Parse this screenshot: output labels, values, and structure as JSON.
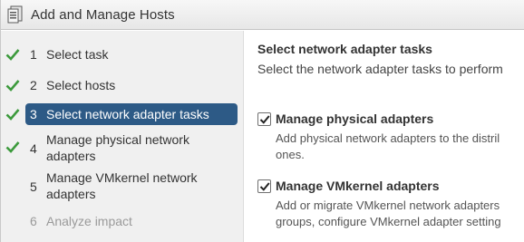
{
  "window": {
    "title": "Add and Manage Hosts",
    "icon": "hosts-wizard-icon"
  },
  "steps": [
    {
      "number": "1",
      "label": "Select task",
      "completed": true,
      "active": false
    },
    {
      "number": "2",
      "label": "Select hosts",
      "completed": true,
      "active": false
    },
    {
      "number": "3",
      "label": "Select network adapter tasks",
      "completed": true,
      "active": true
    },
    {
      "number": "4",
      "label_line1": "Manage physical network",
      "label_line2": "adapters",
      "completed": true,
      "active": false
    },
    {
      "number": "5",
      "label_line1": "Manage VMkernel network",
      "label_line2": "adapters",
      "completed": false,
      "active": false
    },
    {
      "number": "6",
      "label": "Analyze impact",
      "completed": false,
      "active": false,
      "disabled": true
    }
  ],
  "content": {
    "title": "Select network adapter tasks",
    "subtitle": "Select the network adapter tasks to perform",
    "options": [
      {
        "label": "Manage physical adapters",
        "checked": true,
        "desc_line1": "Add physical network adapters to the distril",
        "desc_line2": "ones."
      },
      {
        "label": "Manage VMkernel adapters",
        "checked": true,
        "desc_line1": "Add or migrate VMkernel network adapters",
        "desc_line2": "groups, configure VMkernel adapter setting"
      }
    ]
  },
  "colors": {
    "accent": "#2d5a86",
    "check": "#3c9a3c",
    "panel": "#f0f0f0"
  }
}
